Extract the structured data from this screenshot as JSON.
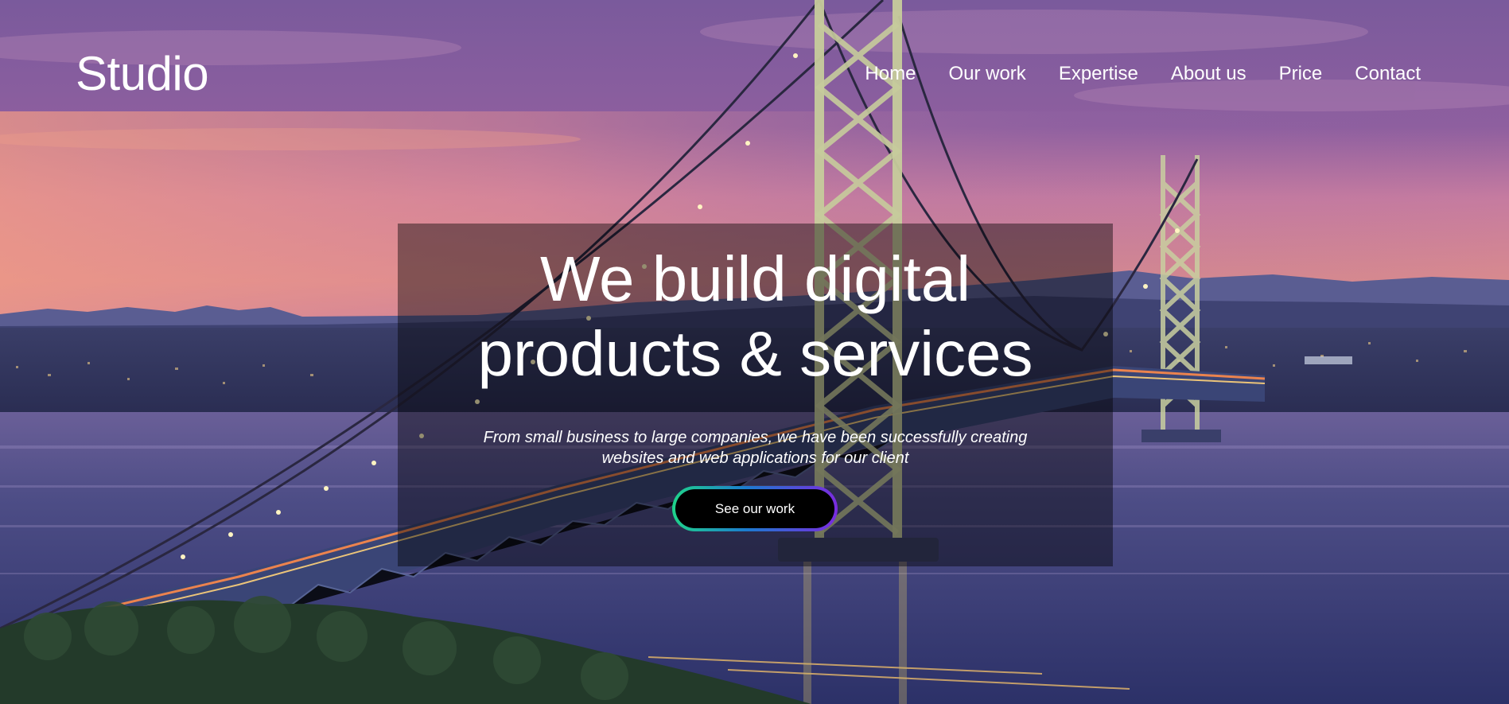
{
  "brand": {
    "logo_text": "Studio"
  },
  "nav": {
    "items": [
      {
        "label": "Home"
      },
      {
        "label": "Our work"
      },
      {
        "label": "Expertise"
      },
      {
        "label": "About us"
      },
      {
        "label": "Price"
      },
      {
        "label": "Contact"
      }
    ]
  },
  "hero": {
    "headline_line1": "We build digital",
    "headline_line2": "products & services",
    "subtext_line1": "From small business to large companies, we have been successfully creating",
    "subtext_line2": "websites and web applications for our client",
    "cta_label": "See our work",
    "background_image": "suspension-bridge-at-dusk-photo"
  },
  "colors": {
    "text": "#ffffff",
    "cta_background": "#000000",
    "cta_gradient_start": "#1fd38a",
    "cta_gradient_mid": "#1c7bd0",
    "cta_gradient_end": "#7a2be0",
    "overlay": "rgba(0,0,0,0.42)"
  }
}
